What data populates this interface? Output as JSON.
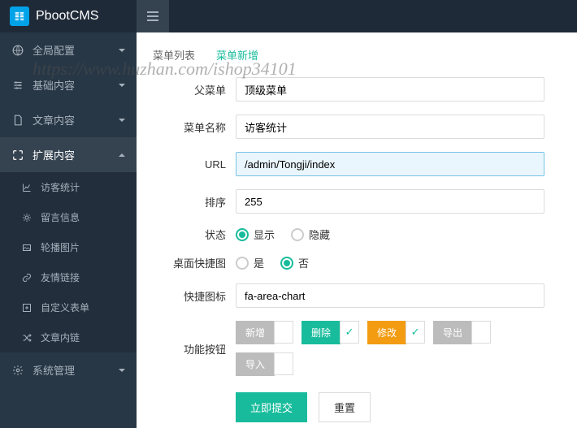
{
  "header": {
    "logo_text": "PbootCMS"
  },
  "sidebar": {
    "global": "全局配置",
    "basic": "基础内容",
    "article": "文章内容",
    "extend": "扩展内容",
    "sub": {
      "visitor": "访客统计",
      "message": "留言信息",
      "carousel": "轮播图片",
      "friendlink": "友情链接",
      "custom_form": "自定义表单",
      "inner_link": "文章内链"
    },
    "system": "系统管理"
  },
  "tabs": {
    "list": "菜单列表",
    "add": "菜单新增"
  },
  "form": {
    "parent_label": "父菜单",
    "parent_value": "顶级菜单",
    "name_label": "菜单名称",
    "name_value": "访客统计",
    "url_label": "URL",
    "url_value": "/admin/Tongji/index",
    "sort_label": "排序",
    "sort_value": "255",
    "status_label": "状态",
    "status_show": "显示",
    "status_hide": "隐藏",
    "shortcut_label": "桌面快捷图",
    "shortcut_yes": "是",
    "shortcut_no": "否",
    "icon_label": "快捷图标",
    "icon_value": "fa-area-chart",
    "fn_btn_label": "功能按钮",
    "btn_add": "新增",
    "btn_delete": "删除",
    "btn_modify": "修改",
    "btn_export": "导出",
    "btn_import": "导入",
    "submit": "立即提交",
    "reset": "重置"
  },
  "watermark": "https://www.huzhan.com/ishop34101"
}
